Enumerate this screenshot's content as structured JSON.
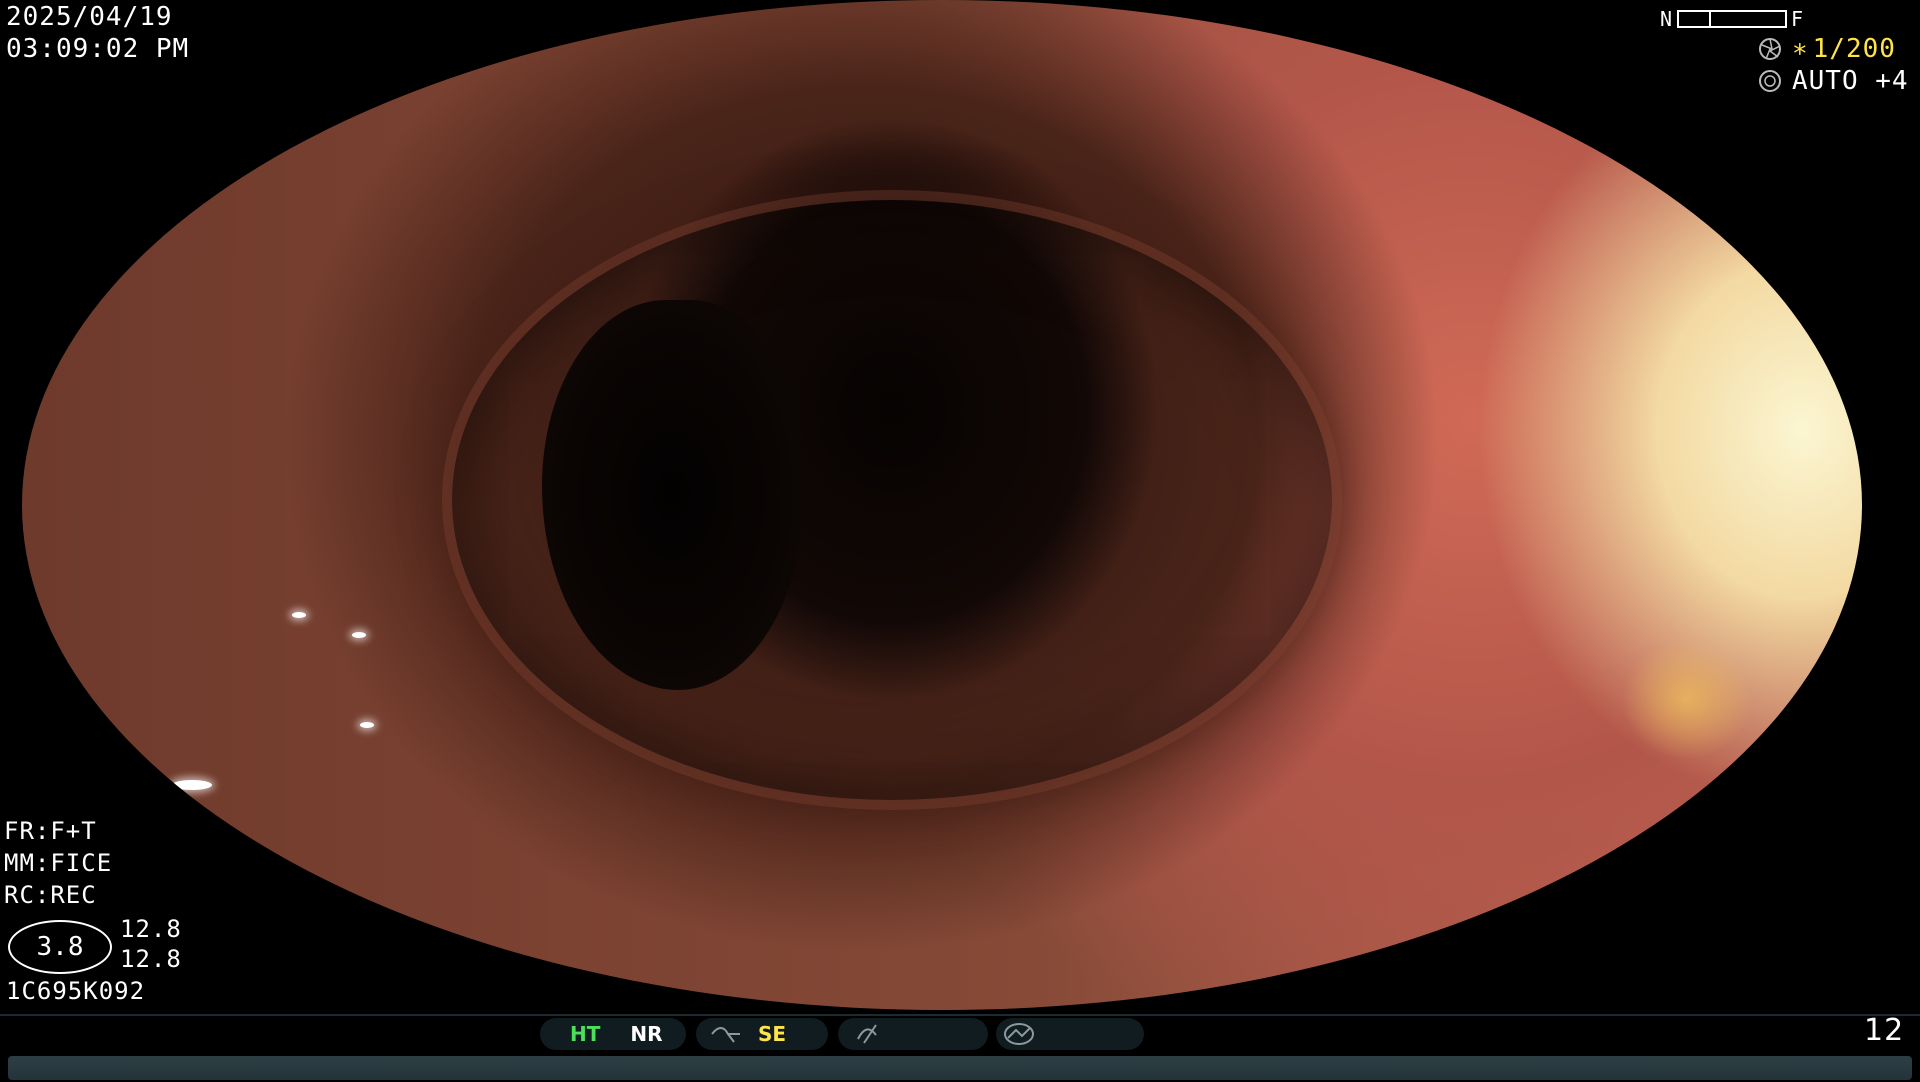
{
  "datetime": {
    "date": "2025/04/19",
    "time": "03:09:02  PM"
  },
  "top_right": {
    "near_label": "N",
    "far_label": "F",
    "shutter_value": "1/200",
    "shutter_prefix": "∗",
    "auto_value": "AUTO +4",
    "icons": [
      "shutter-dial-icon",
      "iris-dial-icon"
    ]
  },
  "left_panel": {
    "fr": "FR:F+T",
    "mm": "MM:FICE",
    "rc": "RC:REC",
    "ellipse_value": "3.8",
    "value_a": "12.8",
    "value_b": "12.8",
    "serial": "1C695K092"
  },
  "status_bar": {
    "ht_label": "HT",
    "nr_label": "NR",
    "se_label": "SE",
    "frame_number": "12",
    "icons": [
      "wave-icon",
      "slash-wave-icon",
      "dome-icon"
    ],
    "colors": {
      "ht": "#4be05a",
      "se": "#ffe34a",
      "nr": "#ffffff"
    }
  }
}
